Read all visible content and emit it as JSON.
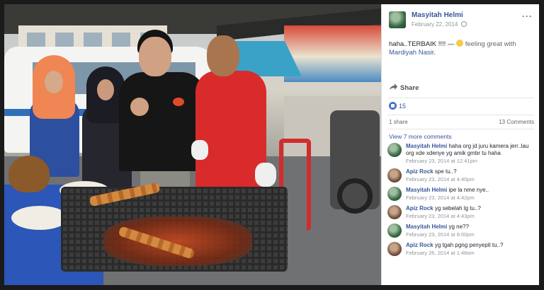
{
  "post": {
    "author": "Masyitah Helmi",
    "date": "February 22, 2014",
    "text_prefix": "haha..TERBAIK !!!! — ",
    "feeling": "feeling great with",
    "tagged": "Mardiyah Nasir",
    "tagged_suffix": ".",
    "share_label": "Share",
    "likes_count": "15",
    "shares": "1 share",
    "comments_count": "13 Comments",
    "view_more": "View 7 more comments"
  },
  "comments": [
    {
      "name": "Masyitah Helmi",
      "text": "haha org jd juru kamera jerr..lau org xde xdenye yg amik gmbr tu haha",
      "date": "February 23, 2014 at 12:41pm"
    },
    {
      "name": "Apiz Rock",
      "text": "spe tu..?",
      "date": "February 23, 2014 at 4:40pm"
    },
    {
      "name": "Masyitah Helmi",
      "text": "ipe la nme nye..",
      "date": "February 23, 2014 at 4:42pm"
    },
    {
      "name": "Apiz Rock",
      "text": "yg sebelah lg tu..?",
      "date": "February 23, 2014 at 4:43pm"
    },
    {
      "name": "Masyitah Helmi",
      "text": "yg ne??",
      "date": "February 23, 2014 at 8:00pm"
    },
    {
      "name": "Apiz Rock",
      "text": "yg tgah pgng penyepit tu..?",
      "date": "February 26, 2014 at 1:48am"
    }
  ],
  "icons": {
    "more": "ellipsis-icon",
    "share": "share-arrow-icon",
    "like": "thumbs-up-icon",
    "globe": "globe-icon",
    "emoji": "smiley-icon"
  },
  "colors": {
    "link": "#365899",
    "meta": "#90949c",
    "like_blue": "#4b6fcf"
  }
}
